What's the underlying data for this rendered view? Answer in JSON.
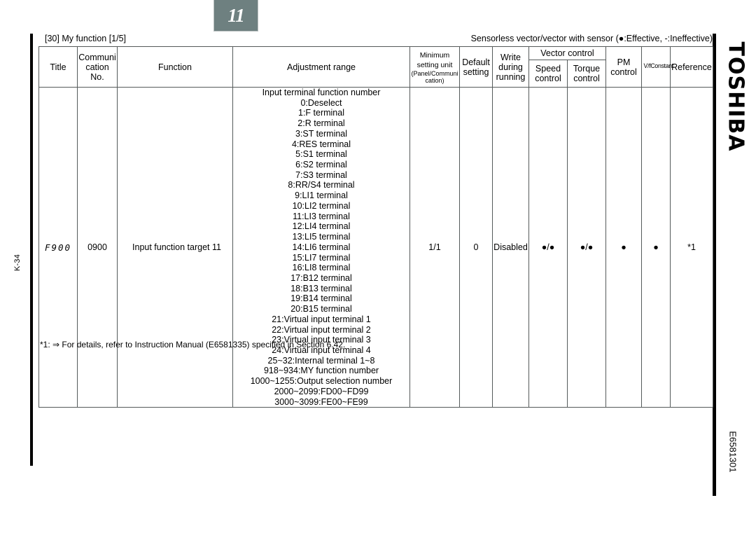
{
  "chapter_tab": {
    "number": "11"
  },
  "page_marker": {
    "label": "K-34"
  },
  "brand": {
    "name": "TOSHIBA"
  },
  "doc_code": {
    "value": "E6581301"
  },
  "section_caption": "[30] My function [1/5]",
  "legend_note": "Sensorless vector/vector with sensor (●:Effective, -:Ineffective)",
  "table": {
    "headers": {
      "title": "Title",
      "communication_no": "Communi\ncation\nNo.",
      "communication_no_l1": "Communi",
      "communication_no_l2": "cation",
      "communication_no_l3": "No.",
      "function": "Function",
      "adjustment_range": "Adjustment range",
      "minimum_setting_unit_l1": "Minimum",
      "minimum_setting_unit_l2": "setting unit",
      "minimum_setting_unit_l3": "(Panel/Communi",
      "minimum_setting_unit_l4": "cation)",
      "default_setting_l1": "Default",
      "default_setting_l2": "setting",
      "write_during_running_l1": "Write during",
      "write_during_running_l2": "running",
      "vector_control": "Vector control",
      "speed_control_l1": "Speed",
      "speed_control_l2": "control",
      "torque_control_l1": "Torque",
      "torque_control_l2": "control",
      "pm_control_l1": "PM",
      "pm_control_l2": "control",
      "vf_constant": "V/fConstant",
      "reference": "Reference"
    },
    "rows": [
      {
        "title": "F900",
        "communication_no": "0900",
        "function": "Input function target 11",
        "adjustment_range": "Input terminal function number\n0:Deselect\n1:F terminal\n2:R terminal\n3:ST terminal\n4:RES terminal\n5:S1 terminal\n6:S2 terminal\n7:S3 terminal\n8:RR/S4 terminal\n9:LI1 terminal\n10:LI2 terminal\n11:LI3 terminal\n12:LI4 terminal\n13:LI5 terminal\n14:LI6 terminal\n15:LI7 terminal\n16:LI8 terminal\n17:B12 terminal\n18:B13 terminal\n19:B14 terminal\n20:B15 terminal\n21:Virtual input terminal 1\n22:Virtual input terminal 2\n23:Virtual input terminal 3\n24:Virtual input terminal 4\n25~32:Internal terminal 1~8\n918~934:MY function number\n1000~1255:Output selection number\n2000~2099:FD00~FD99\n3000~3099:FE00~FE99",
        "minimum_setting_unit": "1/1",
        "default_setting": "0",
        "write_during_running": "Disabled",
        "speed_control": "●/●",
        "torque_control": "●/●",
        "pm_control": "●",
        "vf_constant": "●",
        "reference": "*1"
      }
    ]
  },
  "footnote": "*1: ⇒ For details, refer to Instruction Manual (E6581335) specified in Section 6.42.",
  "colors": {
    "tab_background": "#6e8080",
    "tab_text": "#ffffff",
    "border": "#555a5a",
    "text": "#000000"
  }
}
